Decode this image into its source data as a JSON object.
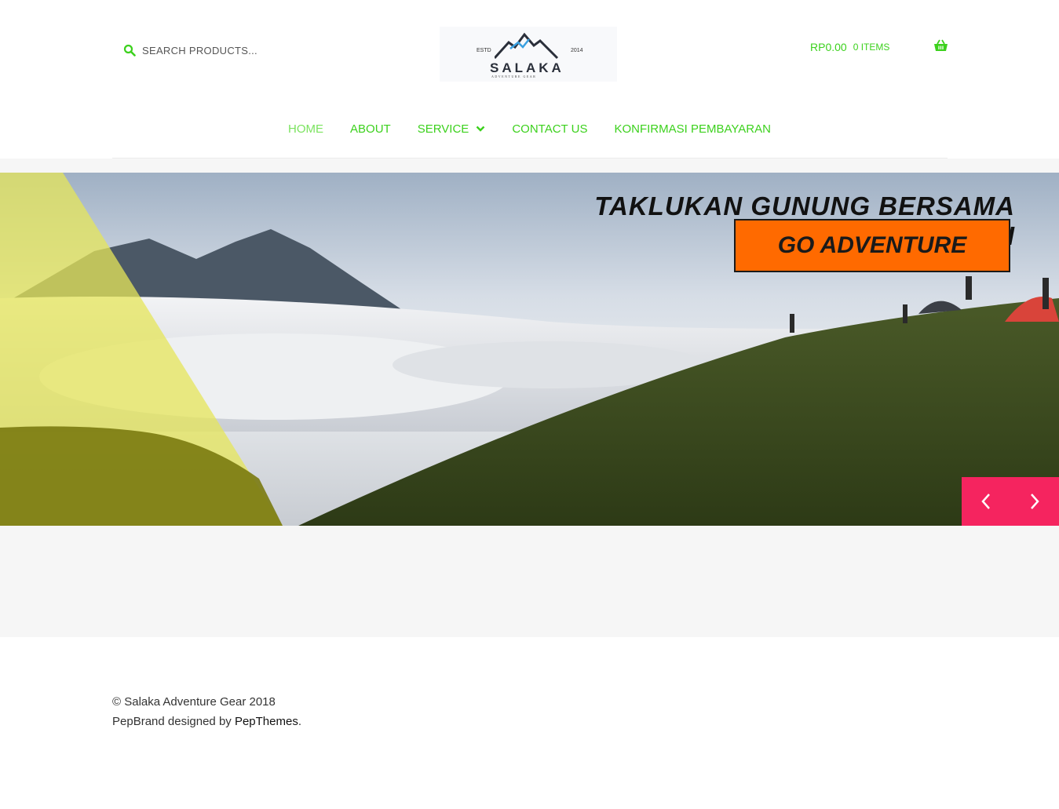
{
  "search": {
    "placeholder": "SEARCH PRODUCTS..."
  },
  "logo": {
    "estd": "ESTD",
    "year": "2014",
    "name": "SALAKA",
    "tagline": "ADVENTURE GEAR"
  },
  "cart": {
    "amount": "RP0.00",
    "items": "0 ITEMS"
  },
  "nav": {
    "items": [
      {
        "label": "HOME"
      },
      {
        "label": "ABOUT"
      },
      {
        "label": "SERVICE"
      },
      {
        "label": "CONTACT US"
      },
      {
        "label": "KONFIRMASI PEMBAYARAN"
      }
    ]
  },
  "hero": {
    "headline": "TAKLUKAN GUNUNG BERSAMA KAMI",
    "cta": "GO ADVENTURE"
  },
  "footer": {
    "copyright": "© Salaka Adventure Gear 2018",
    "credit_prefix": "PepBrand designed by ",
    "credit_link": "PepThemes",
    "credit_suffix": "."
  },
  "colors": {
    "accent_green": "#3cd11d",
    "active_green": "#7be35f",
    "cta_orange": "#ff6a00",
    "slider_pink": "#f5245f",
    "overlay_yellow": "#e6e65a"
  }
}
